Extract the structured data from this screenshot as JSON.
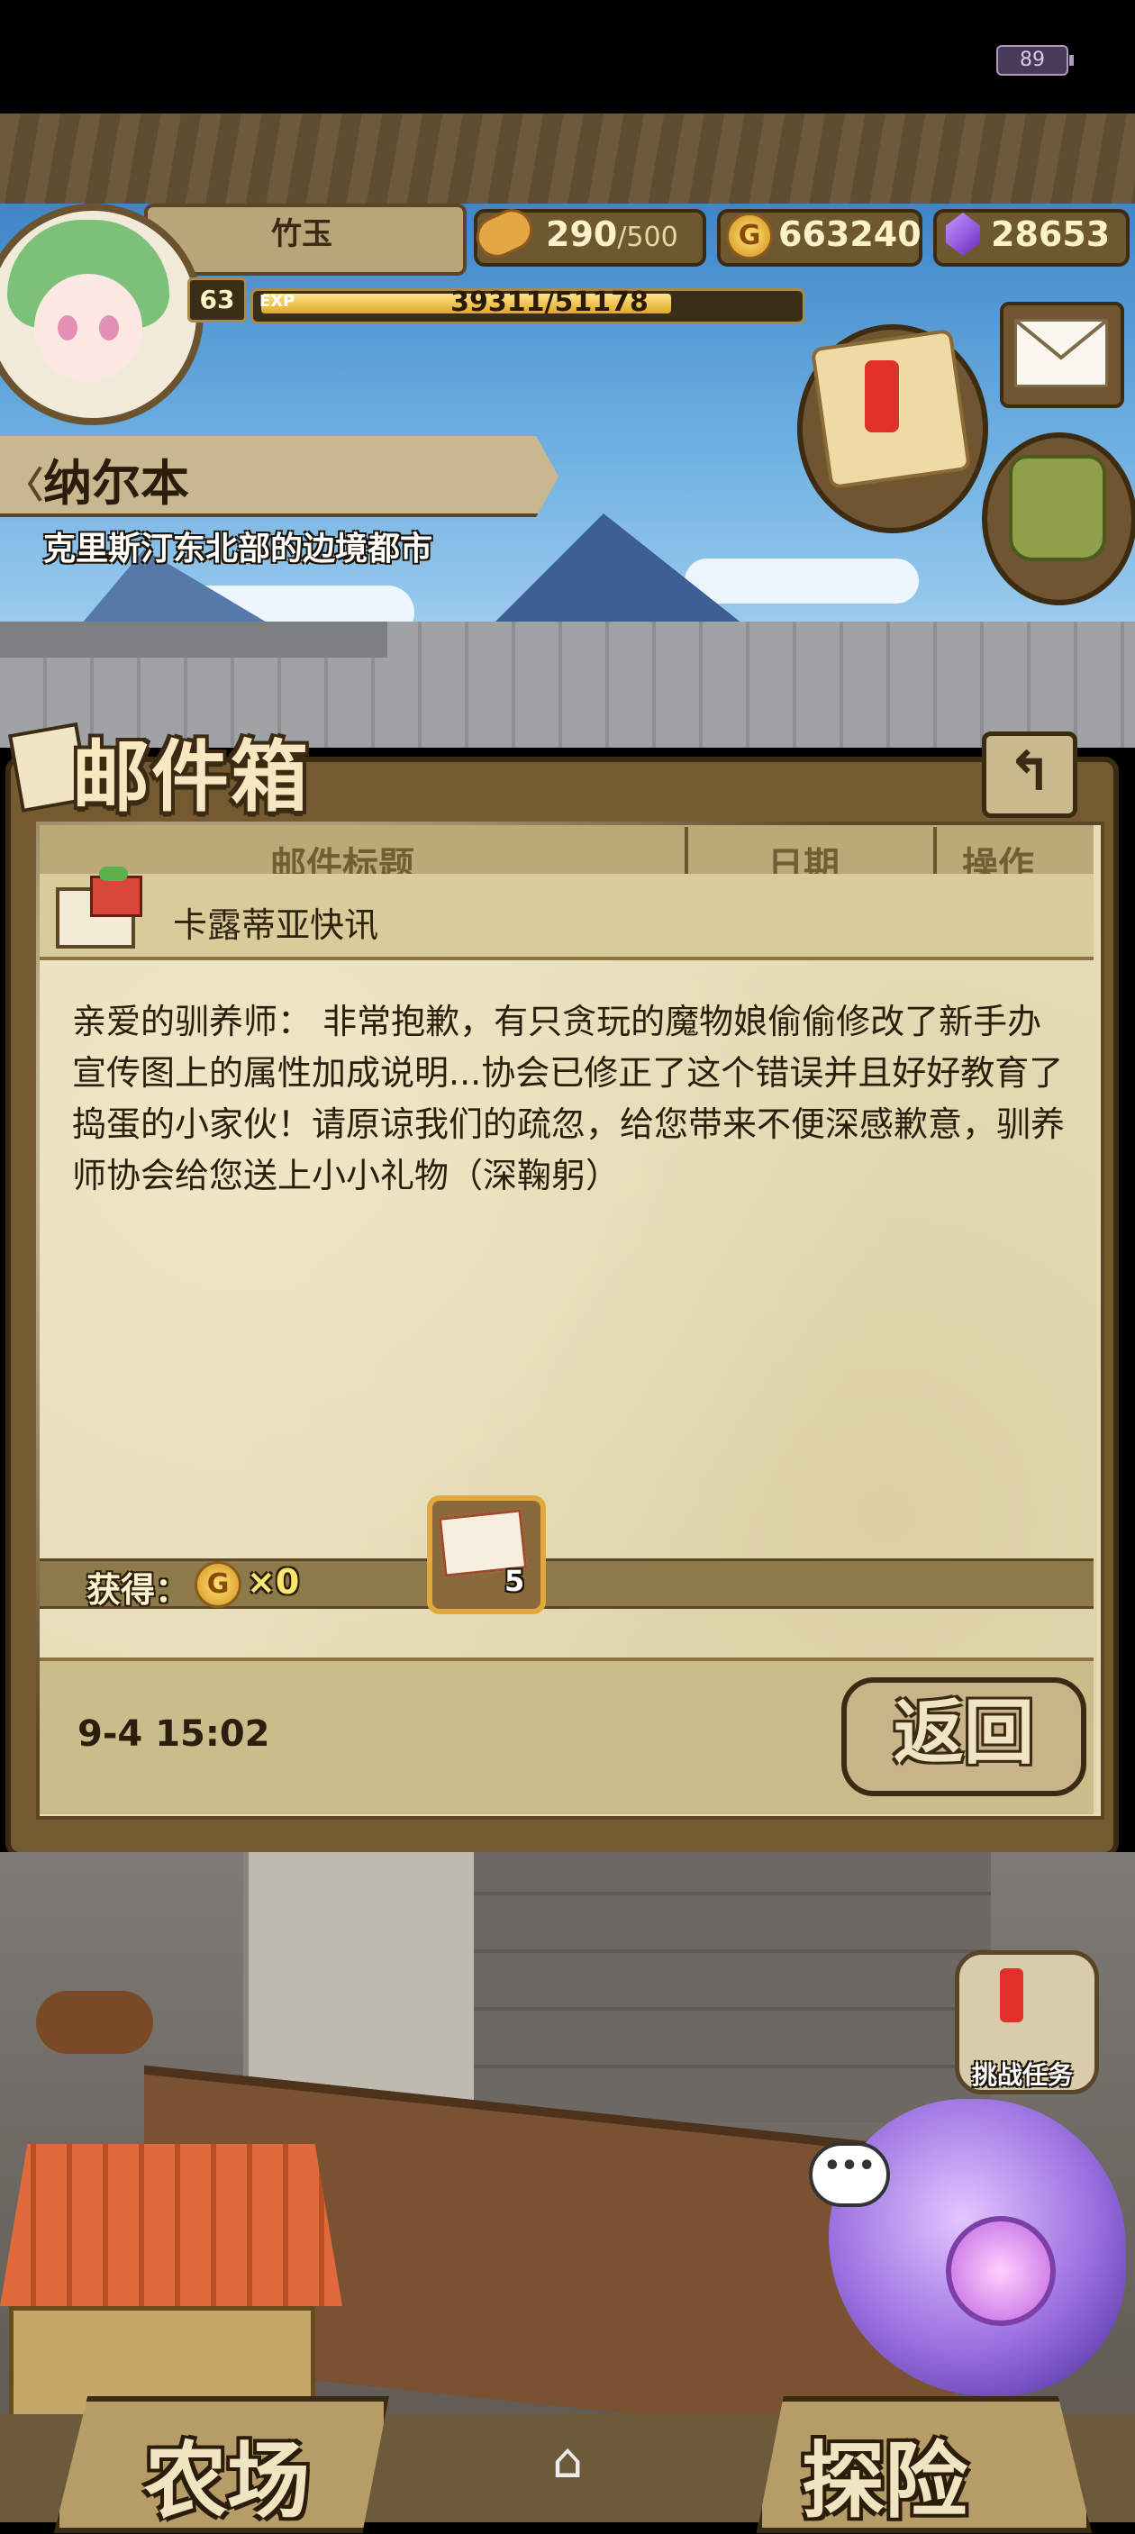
{
  "status": {
    "battery": "89"
  },
  "player": {
    "name": "竹玉",
    "level": "63",
    "exp_tag": "EXP",
    "exp_text": "39311/51178",
    "exp_fraction": 0.768,
    "bread": "290",
    "bread_max": "/500",
    "gold": "663240",
    "gems": "28653"
  },
  "location": {
    "name": "纳尔本",
    "desc": "克里斯汀东北部的边境都市",
    "chevron": "〈"
  },
  "mailbox": {
    "title": "邮件箱",
    "back_icon": "↰",
    "columns": [
      "邮件标题",
      "日期",
      "操作"
    ],
    "subject": "卡露蒂亚快讯",
    "body": "亲爱的驯养师： 非常抱歉，有只贪玩的魔物娘偷偷修改了新手办宣传图上的属性加成说明...协会已修正了这个错误并且好好教育了捣蛋的小家伙！请原谅我们的疏忽，给您带来不便深感歉意，驯养师协会给您送上小小礼物（深鞠躬）",
    "reward_label": "获得：",
    "gold_reward": "×0",
    "coin_glyph": "G",
    "item_count": "5",
    "date": "9-4 15:02",
    "return_label": "返回"
  },
  "hud": {
    "quest_label": "挑战任务",
    "bubble": "•••",
    "farm_label": "农场",
    "explore_label": "探险",
    "home_icon": "⌂"
  },
  "colors": {
    "gold": "#d39218",
    "gem": "#6a2ac0",
    "exp": "#e0a825",
    "alert": "#e0302a"
  }
}
